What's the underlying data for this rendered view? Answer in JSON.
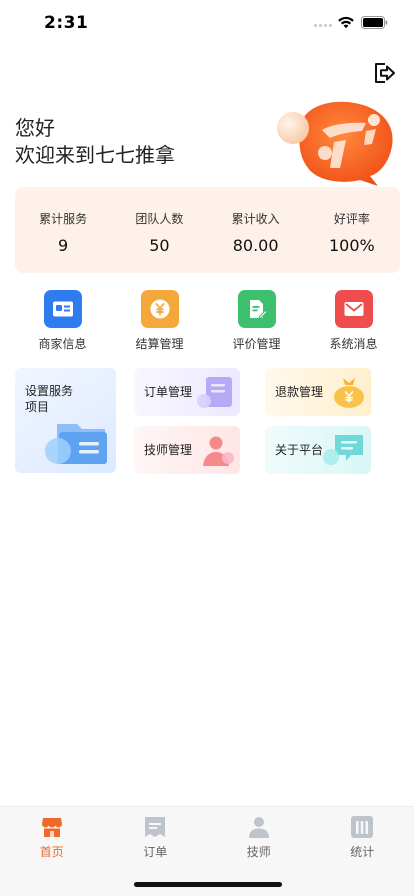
{
  "status_bar": {
    "time": "2:31"
  },
  "greeting": {
    "line1": "您好",
    "line2": "欢迎来到七七推拿"
  },
  "stats": [
    {
      "label": "累计服务",
      "value": "9"
    },
    {
      "label": "团队人数",
      "value": "50"
    },
    {
      "label": "累计收入",
      "value": "80.00"
    },
    {
      "label": "好评率",
      "value": "100%"
    }
  ],
  "quick_actions": [
    {
      "label": "商家信息",
      "icon": "id-card-icon",
      "color": "#2f7cf0"
    },
    {
      "label": "结算管理",
      "icon": "yuan-coin-icon",
      "color": "#f5a83a"
    },
    {
      "label": "评价管理",
      "icon": "document-edit-icon",
      "color": "#3cc06e"
    },
    {
      "label": "系统消息",
      "icon": "envelope-icon",
      "color": "#ef4d4d"
    }
  ],
  "tiles": {
    "service_setup": "设置服务\n项目",
    "orders": "订单管理",
    "refunds": "退款管理",
    "technicians": "技师管理",
    "about": "关于平台"
  },
  "tab_bar": [
    {
      "label": "首页",
      "icon": "shop-icon",
      "active": true
    },
    {
      "label": "订单",
      "icon": "order-list-icon",
      "active": false
    },
    {
      "label": "技师",
      "icon": "person-icon",
      "active": false
    },
    {
      "label": "统计",
      "icon": "bar-stats-icon",
      "active": false
    }
  ],
  "colors": {
    "accent": "#f0692c",
    "stats_bg": "#fdf1ea",
    "tab_inactive": "#bfc3cc"
  }
}
